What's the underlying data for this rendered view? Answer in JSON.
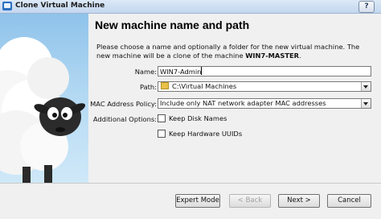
{
  "window": {
    "title": "Clone Virtual Machine",
    "help_label": "?"
  },
  "page": {
    "heading": "New machine name and path",
    "description_pre": "Please choose a name and optionally a folder for the new virtual machine. The new machine will be a clone of the machine ",
    "source_machine": "WIN7-MASTER",
    "description_post": "."
  },
  "form": {
    "name_label": "Name:",
    "name_value": "WIN7-Admin",
    "path_label": "Path:",
    "path_value": "C:\\Virtual Machines",
    "mac_label": "MAC Address Policy:",
    "mac_value": "Include only NAT network adapter MAC addresses",
    "options_label": "Additional Options:",
    "keep_disk_names_label": "Keep Disk Names",
    "keep_hw_uuids_label": "Keep Hardware UUIDs"
  },
  "buttons": {
    "expert_mode": "Expert Mode",
    "back": "< Back",
    "next": "Next >",
    "cancel": "Cancel"
  }
}
